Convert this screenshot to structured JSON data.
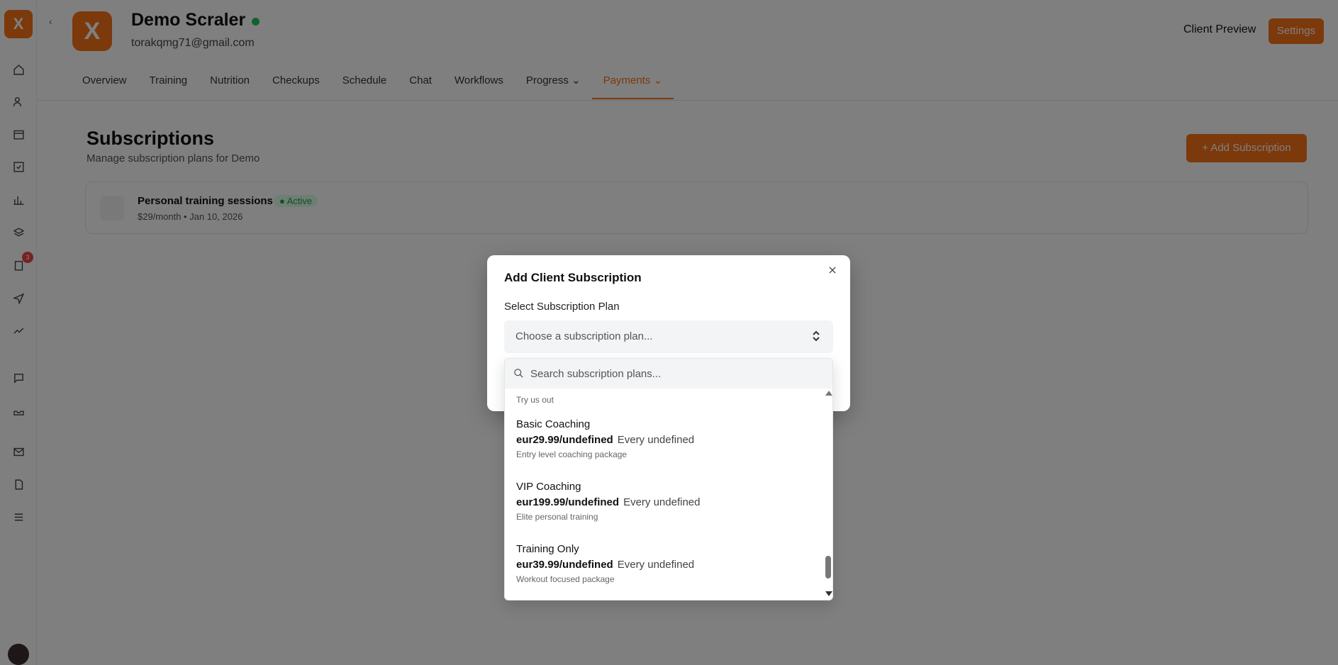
{
  "sidebar": {
    "logo": "X",
    "icons": [
      "home-icon",
      "users-icon",
      "calendar-icon",
      "check-icon",
      "chart-icon",
      "layers-icon",
      "clipboard-icon",
      "send-icon",
      "trending-icon",
      "chat-icon",
      "inbox-icon",
      "mail-icon",
      "doc-icon",
      "list-icon"
    ],
    "badge": "3"
  },
  "client": {
    "avatar_letter": "X",
    "name": "Demo Scraler",
    "email": "torakqmg71@gmail.com"
  },
  "header": {
    "client_preview": "Client Preview",
    "settings": "Settings"
  },
  "tabs": [
    {
      "label": "Overview"
    },
    {
      "label": "Training"
    },
    {
      "label": "Nutrition"
    },
    {
      "label": "Checkups"
    },
    {
      "label": "Schedule"
    },
    {
      "label": "Chat"
    },
    {
      "label": "Workflows"
    },
    {
      "label": "Progress ⌄"
    },
    {
      "label": "Payments ⌄"
    }
  ],
  "page": {
    "title": "Subscriptions",
    "subtitle": "Manage subscription plans for Demo",
    "add_button": "+ Add Subscription"
  },
  "existing_subscription": {
    "name": "Personal training sessions",
    "status": "● Active",
    "meta": "$29/month  •  Jan 10, 2026"
  },
  "modal": {
    "title": "Add Client Subscription",
    "field_label": "Select Subscription Plan",
    "placeholder": "Choose a subscription plan..."
  },
  "dropdown": {
    "search_placeholder": "Search subscription plans...",
    "partial_item_desc": "Try us out",
    "plans": [
      {
        "name": "Basic Coaching",
        "price": "eur29.99/undefined",
        "interval": "Every undefined",
        "description": "Entry level coaching package"
      },
      {
        "name": "VIP Coaching",
        "price": "eur199.99/undefined",
        "interval": "Every undefined",
        "description": "Elite personal training"
      },
      {
        "name": "Training Only",
        "price": "eur39.99/undefined",
        "interval": "Every undefined",
        "description": "Workout focused package"
      }
    ]
  },
  "colors": {
    "accent": "#f97316",
    "success": "#22c55e",
    "overlay": "rgba(0,0,0,0.5)"
  }
}
